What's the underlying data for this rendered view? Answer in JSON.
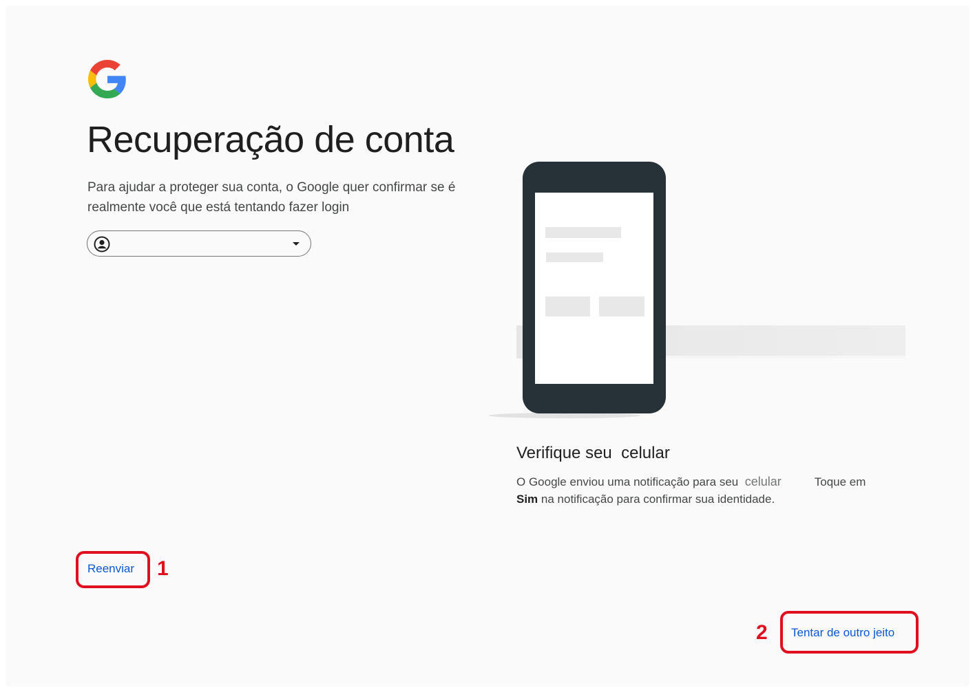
{
  "page": {
    "title": "Recuperação de conta",
    "subtitle": "Para ajudar a proteger sua conta, o Google quer confirmar se é realmente você que está tentando fazer login"
  },
  "account_selector": {
    "email": "",
    "icon": "account-circle-icon",
    "dropdown_icon": "arrow-drop-down-icon"
  },
  "verification": {
    "heading_part1": "Verifique seu",
    "heading_part2": "celular",
    "text_part1": "O Google enviou uma notificação para seu",
    "text_device": "celular",
    "text_part2": "Toque em",
    "text_bold": "Sim",
    "text_part3": "na notificação para confirmar sua identidade."
  },
  "actions": {
    "resend_label": "Reenviar",
    "try_other_label": "Tentar de outro jeito"
  },
  "annotations": {
    "marker_1": "1",
    "marker_2": "2"
  },
  "colors": {
    "link": "#0b57d0",
    "highlight": "#e01020",
    "phone_body": "#263238",
    "background": "#fafafa"
  }
}
